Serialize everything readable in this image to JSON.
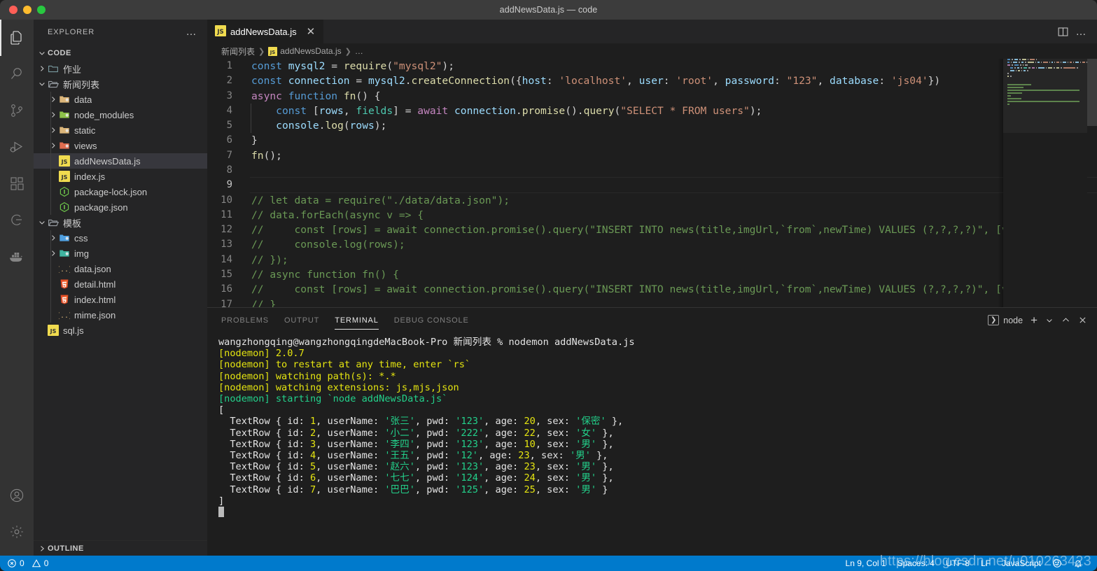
{
  "window": {
    "title": "addNewsData.js — code"
  },
  "activitybar": {
    "items": [
      {
        "name": "explorer-icon",
        "label": "Explorer",
        "active": true
      },
      {
        "name": "search-icon",
        "label": "Search",
        "active": false
      },
      {
        "name": "source-control-icon",
        "label": "Source Control",
        "active": false
      },
      {
        "name": "run-and-debug-icon",
        "label": "Run and Debug",
        "active": false
      },
      {
        "name": "extensions-icon",
        "label": "Extensions",
        "active": false
      },
      {
        "name": "remote-explorer-icon",
        "label": "Remote Explorer",
        "active": false
      },
      {
        "name": "docker-icon",
        "label": "Docker",
        "active": false
      }
    ],
    "bottom": [
      {
        "name": "account-icon",
        "label": "Accounts"
      },
      {
        "name": "settings-gear-icon",
        "label": "Manage"
      }
    ]
  },
  "sidebar": {
    "title": "EXPLORER",
    "more_label": "…",
    "outline_label": "OUTLINE",
    "root": {
      "label": "CODE",
      "expanded": true
    },
    "tree": [
      {
        "label": "作业",
        "depth": 1,
        "type": "folder",
        "icon": "folder-teal",
        "expanded": false,
        "selected": false
      },
      {
        "label": "新闻列表",
        "depth": 1,
        "type": "folder",
        "icon": "folder-open",
        "expanded": true,
        "selected": false
      },
      {
        "label": "data",
        "depth": 2,
        "type": "folder",
        "icon": "folder-yellow",
        "expanded": false,
        "selected": false
      },
      {
        "label": "node_modules",
        "depth": 2,
        "type": "folder",
        "icon": "folder-green",
        "expanded": false,
        "selected": false
      },
      {
        "label": "static",
        "depth": 2,
        "type": "folder",
        "icon": "folder-yellow",
        "expanded": false,
        "selected": false
      },
      {
        "label": "views",
        "depth": 2,
        "type": "folder",
        "icon": "folder-red",
        "expanded": false,
        "selected": false
      },
      {
        "label": "addNewsData.js",
        "depth": 2,
        "type": "file",
        "icon": "js",
        "expanded": null,
        "selected": true
      },
      {
        "label": "index.js",
        "depth": 2,
        "type": "file",
        "icon": "js",
        "expanded": null,
        "selected": false
      },
      {
        "label": "package-lock.json",
        "depth": 2,
        "type": "file",
        "icon": "node",
        "expanded": null,
        "selected": false
      },
      {
        "label": "package.json",
        "depth": 2,
        "type": "file",
        "icon": "node",
        "expanded": null,
        "selected": false
      },
      {
        "label": "模板",
        "depth": 1,
        "type": "folder",
        "icon": "folder-open",
        "expanded": true,
        "selected": false
      },
      {
        "label": "css",
        "depth": 2,
        "type": "folder",
        "icon": "folder-blue",
        "expanded": false,
        "selected": false
      },
      {
        "label": "img",
        "depth": 2,
        "type": "folder",
        "icon": "folder-mint",
        "expanded": false,
        "selected": false
      },
      {
        "label": "data.json",
        "depth": 2,
        "type": "file",
        "icon": "json",
        "expanded": null,
        "selected": false
      },
      {
        "label": "detail.html",
        "depth": 2,
        "type": "file",
        "icon": "html",
        "expanded": null,
        "selected": false
      },
      {
        "label": "index.html",
        "depth": 2,
        "type": "file",
        "icon": "html",
        "expanded": null,
        "selected": false
      },
      {
        "label": "mime.json",
        "depth": 2,
        "type": "file",
        "icon": "json",
        "expanded": null,
        "selected": false
      },
      {
        "label": "sql.js",
        "depth": 1,
        "type": "file",
        "icon": "js",
        "expanded": null,
        "selected": false
      }
    ]
  },
  "editor": {
    "tabs": [
      {
        "label": "addNewsData.js",
        "icon": "js-icon",
        "active": true,
        "close_label": "✕"
      }
    ],
    "actions": [
      {
        "name": "split-editor-icon"
      },
      {
        "name": "more-actions-icon",
        "label": "…"
      }
    ],
    "breadcrumbs": [
      {
        "label": "新闻列表",
        "icon": null
      },
      {
        "label": "addNewsData.js",
        "icon": "js-icon"
      },
      {
        "label": "…",
        "icon": null
      }
    ],
    "cursor_line": 9,
    "lines": [
      {
        "n": 1,
        "indent": 0,
        "tokens": [
          [
            "kw",
            "const"
          ],
          [
            "pln",
            " "
          ],
          [
            "var",
            "mysql2"
          ],
          [
            "pln",
            " = "
          ],
          [
            "fn",
            "require"
          ],
          [
            "pln",
            "("
          ],
          [
            "str",
            "\"mysql2\""
          ],
          [
            "pln",
            ");"
          ]
        ]
      },
      {
        "n": 2,
        "indent": 0,
        "tokens": [
          [
            "kw",
            "const"
          ],
          [
            "pln",
            " "
          ],
          [
            "var",
            "connection"
          ],
          [
            "pln",
            " = "
          ],
          [
            "var",
            "mysql2"
          ],
          [
            "pln",
            "."
          ],
          [
            "fn",
            "createConnection"
          ],
          [
            "pln",
            "({"
          ],
          [
            "var",
            "host"
          ],
          [
            "pln",
            ": "
          ],
          [
            "str",
            "'localhost'"
          ],
          [
            "pln",
            ", "
          ],
          [
            "var",
            "user"
          ],
          [
            "pln",
            ": "
          ],
          [
            "str",
            "'root'"
          ],
          [
            "pln",
            ", "
          ],
          [
            "var",
            "password"
          ],
          [
            "pln",
            ": "
          ],
          [
            "str",
            "\"123\""
          ],
          [
            "pln",
            ", "
          ],
          [
            "var",
            "database"
          ],
          [
            "pln",
            ": "
          ],
          [
            "str",
            "'js04'"
          ],
          [
            "pln",
            "})"
          ]
        ]
      },
      {
        "n": 3,
        "indent": 0,
        "tokens": [
          [
            "ctl",
            "async"
          ],
          [
            "pln",
            " "
          ],
          [
            "kw",
            "function"
          ],
          [
            "pln",
            " "
          ],
          [
            "fn",
            "fn"
          ],
          [
            "pln",
            "() {"
          ]
        ]
      },
      {
        "n": 4,
        "indent": 1,
        "tokens": [
          [
            "kw",
            "const"
          ],
          [
            "pln",
            " ["
          ],
          [
            "var",
            "rows"
          ],
          [
            "pln",
            ", "
          ],
          [
            "cls",
            "fields"
          ],
          [
            "pln",
            "] = "
          ],
          [
            "ctl",
            "await"
          ],
          [
            "pln",
            " "
          ],
          [
            "var",
            "connection"
          ],
          [
            "pln",
            "."
          ],
          [
            "fn",
            "promise"
          ],
          [
            "pln",
            "()."
          ],
          [
            "fn",
            "query"
          ],
          [
            "pln",
            "("
          ],
          [
            "str",
            "\"SELECT * FROM users\""
          ],
          [
            "pln",
            ");"
          ]
        ]
      },
      {
        "n": 5,
        "indent": 1,
        "tokens": [
          [
            "var",
            "console"
          ],
          [
            "pln",
            "."
          ],
          [
            "fn",
            "log"
          ],
          [
            "pln",
            "("
          ],
          [
            "var",
            "rows"
          ],
          [
            "pln",
            ");"
          ]
        ]
      },
      {
        "n": 6,
        "indent": 0,
        "tokens": [
          [
            "pln",
            "}"
          ]
        ]
      },
      {
        "n": 7,
        "indent": 0,
        "tokens": [
          [
            "fn",
            "fn"
          ],
          [
            "pln",
            "();"
          ]
        ]
      },
      {
        "n": 8,
        "indent": 0,
        "tokens": []
      },
      {
        "n": 9,
        "indent": 0,
        "tokens": []
      },
      {
        "n": 10,
        "indent": 0,
        "tokens": [
          [
            "cmt",
            "// let data = require(\"./data/data.json\");"
          ]
        ]
      },
      {
        "n": 11,
        "indent": 0,
        "tokens": [
          [
            "cmt",
            "// data.forEach(async v => {"
          ]
        ]
      },
      {
        "n": 12,
        "indent": 0,
        "tokens": [
          [
            "cmt",
            "//     const [rows] = await connection.promise().query(\"INSERT INTO news(title,imgUrl,`from`,newTime) VALUES (?,?,?,?)\", [v.ti"
          ]
        ]
      },
      {
        "n": 13,
        "indent": 0,
        "tokens": [
          [
            "cmt",
            "//     console.log(rows);"
          ]
        ]
      },
      {
        "n": 14,
        "indent": 0,
        "tokens": [
          [
            "cmt",
            "// });"
          ]
        ]
      },
      {
        "n": 15,
        "indent": 0,
        "tokens": [
          [
            "cmt",
            "// async function fn() {"
          ]
        ]
      },
      {
        "n": 16,
        "indent": 0,
        "tokens": [
          [
            "cmt",
            "//     const [rows] = await connection.promise().query(\"INSERT INTO news(title,imgUrl,`from`,newTime) VALUES (?,?,?,?)\", [v.ti"
          ]
        ]
      },
      {
        "n": 17,
        "indent": 0,
        "tokens": [
          [
            "cmt",
            "// }"
          ]
        ]
      }
    ]
  },
  "panel": {
    "tabs": [
      {
        "label": "PROBLEMS",
        "active": false
      },
      {
        "label": "OUTPUT",
        "active": false
      },
      {
        "label": "TERMINAL",
        "active": true
      },
      {
        "label": "DEBUG CONSOLE",
        "active": false
      }
    ],
    "terminal_name": "node",
    "actions": [
      {
        "name": "new-terminal-icon",
        "label": "+"
      },
      {
        "name": "terminal-dropdown-icon",
        "label": "⌄"
      },
      {
        "name": "maximize-panel-icon",
        "label": "⌃"
      },
      {
        "name": "close-panel-icon",
        "label": "✕"
      }
    ],
    "terminal": {
      "prompt": {
        "user_host": "wangzhongqing@wangzhongqingdeMacBook-Pro",
        "cwd": "新闻列表",
        "sigil": "%",
        "command": "nodemon addNewsData.js"
      },
      "nodemon_lines": [
        {
          "tag": "[nodemon]",
          "text": "2.0.7",
          "color": "yellow"
        },
        {
          "tag": "[nodemon]",
          "text": "to restart at any time, enter `rs`",
          "color": "yellow"
        },
        {
          "tag": "[nodemon]",
          "text": "watching path(s): *.*",
          "color": "yellow"
        },
        {
          "tag": "[nodemon]",
          "text": "watching extensions: js,mjs,json",
          "color": "yellow"
        },
        {
          "tag": "[nodemon]",
          "text": "starting `node addNewsData.js`",
          "color": "green"
        }
      ],
      "open_bracket": "[",
      "close_bracket": "]",
      "rows": [
        {
          "id": "1",
          "userName": "张三",
          "pwd": "123",
          "age": "20",
          "sex": "保密",
          "trailing": ","
        },
        {
          "id": "2",
          "userName": "小二",
          "pwd": "222",
          "age": "22",
          "sex": "女",
          "trailing": ","
        },
        {
          "id": "3",
          "userName": "李四",
          "pwd": "123",
          "age": "10",
          "sex": "男",
          "trailing": ","
        },
        {
          "id": "4",
          "userName": "王五",
          "pwd": "12",
          "age": "23",
          "sex": "男",
          "trailing": ","
        },
        {
          "id": "5",
          "userName": "赵六",
          "pwd": "123",
          "age": "23",
          "sex": "男",
          "trailing": ","
        },
        {
          "id": "6",
          "userName": "七七",
          "pwd": "124",
          "age": "24",
          "sex": "男",
          "trailing": ","
        },
        {
          "id": "7",
          "userName": "巴巴",
          "pwd": "125",
          "age": "25",
          "sex": "男",
          "trailing": ""
        }
      ],
      "row_prefix": "TextRow { ",
      "row_suffix": " }"
    }
  },
  "statusbar": {
    "errors": "0",
    "warnings": "0",
    "position": "Ln 9, Col 1",
    "indentation": "Spaces: 4",
    "encoding": "UTF-8",
    "eol": "LF",
    "language": "JavaScript",
    "feedback_icon": "smiley-icon",
    "notifications_icon": "bell-icon"
  },
  "watermark": {
    "text": "https://blog.csdn.net/u010263423"
  },
  "colors": {
    "accent": "#007acc",
    "background": "#1e1e1e",
    "sidebar": "#252526",
    "activitybar": "#333333",
    "titlebar": "#3c3c3c"
  }
}
